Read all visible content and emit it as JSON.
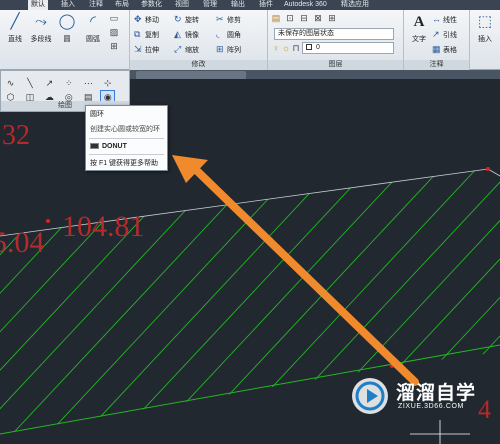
{
  "tabs": [
    "默认",
    "插入",
    "注释",
    "布局",
    "参数化",
    "视图",
    "管理",
    "输出",
    "插件",
    "Autodesk 360",
    "精选应用"
  ],
  "active_tab": "默认",
  "ribbon": {
    "draw": {
      "line": "直线",
      "polyline": "多段线",
      "circle": "圆",
      "arc": "圆弧",
      "title": "绘图"
    },
    "modify": {
      "move": "移动",
      "rotate": "旋转",
      "trim": "修剪",
      "copy": "复制",
      "mirror": "镜像",
      "fillet": "圆角",
      "stretch": "拉伸",
      "scale": "缩放",
      "array": "阵列",
      "title": "修改"
    },
    "layers": {
      "state_combo": "未保存的图层状态",
      "layer_value": "0",
      "title": "图层"
    },
    "annotation": {
      "text": "文字",
      "linear": "线性",
      "leader": "引线",
      "table": "表格",
      "title": "注释"
    },
    "insert": {
      "label": "插入"
    }
  },
  "tooltip": {
    "title": "圆环",
    "description": "创建实心圆或较宽的环",
    "command": "DONUT",
    "help": "按 F1 键获得更多帮助"
  },
  "canvas": {
    "dim_texts": [
      "104.81",
      "5.04",
      "32",
      "4"
    ]
  },
  "watermark": {
    "title": "溜溜自学",
    "url": "ZIXUE.3D66.COM"
  },
  "colors": {
    "canvas_bg": "#212830",
    "hatch": "#22b722",
    "dimension_text": "#b52a2a",
    "arrow": "#f08a2c"
  }
}
